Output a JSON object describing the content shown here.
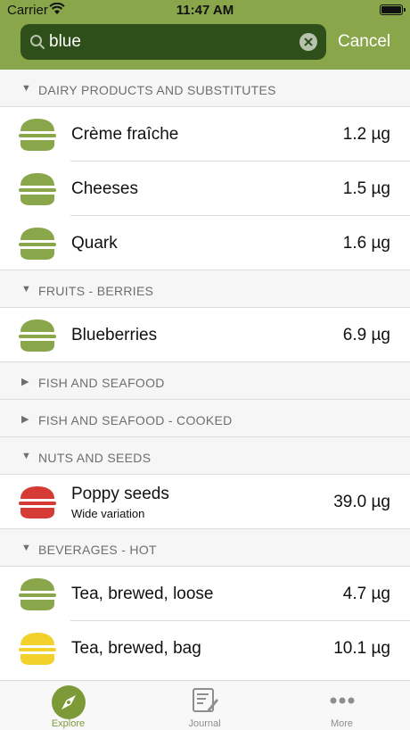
{
  "status_bar": {
    "carrier": "Carrier",
    "time": "11:47 AM"
  },
  "search": {
    "value": "blue",
    "cancel_label": "Cancel"
  },
  "colors": {
    "header": "#8aa64b",
    "search_field": "#2e4f19",
    "green_icon": "#8aa64b",
    "red_icon": "#d63a35",
    "yellow_icon": "#f2d12b",
    "tab_active": "#7c9b38"
  },
  "sections": [
    {
      "title": "DAIRY PRODUCTS AND SUBSTITUTES",
      "expanded": true,
      "items": [
        {
          "name": "Crème fraîche",
          "value": "1.2 µg",
          "icon": "burger-green-icon"
        },
        {
          "name": "Cheeses",
          "value": "1.5 µg",
          "icon": "burger-green-icon"
        },
        {
          "name": "Quark",
          "value": "1.6 µg",
          "icon": "burger-green-icon"
        }
      ]
    },
    {
      "title": "FRUITS - BERRIES",
      "expanded": true,
      "items": [
        {
          "name": "Blueberries",
          "value": "6.9 µg",
          "icon": "burger-green-icon"
        }
      ]
    },
    {
      "title": "FISH AND SEAFOOD",
      "expanded": false,
      "items": []
    },
    {
      "title": "FISH AND SEAFOOD - COOKED",
      "expanded": false,
      "items": []
    },
    {
      "title": "NUTS AND SEEDS",
      "expanded": true,
      "items": [
        {
          "name": "Poppy seeds",
          "subtitle": "Wide variation",
          "value": "39.0 µg",
          "icon": "burger-red-icon"
        }
      ]
    },
    {
      "title": "BEVERAGES - HOT",
      "expanded": true,
      "items": [
        {
          "name": "Tea, brewed, loose",
          "value": "4.7 µg",
          "icon": "burger-green-icon"
        },
        {
          "name": "Tea, brewed, bag",
          "value": "10.1 µg",
          "icon": "burger-yellow-icon"
        }
      ]
    }
  ],
  "tabs": [
    {
      "label": "Explore",
      "icon": "compass-icon",
      "active": true
    },
    {
      "label": "Journal",
      "icon": "journal-icon",
      "active": false
    },
    {
      "label": "More",
      "icon": "more-icon",
      "active": false
    }
  ]
}
